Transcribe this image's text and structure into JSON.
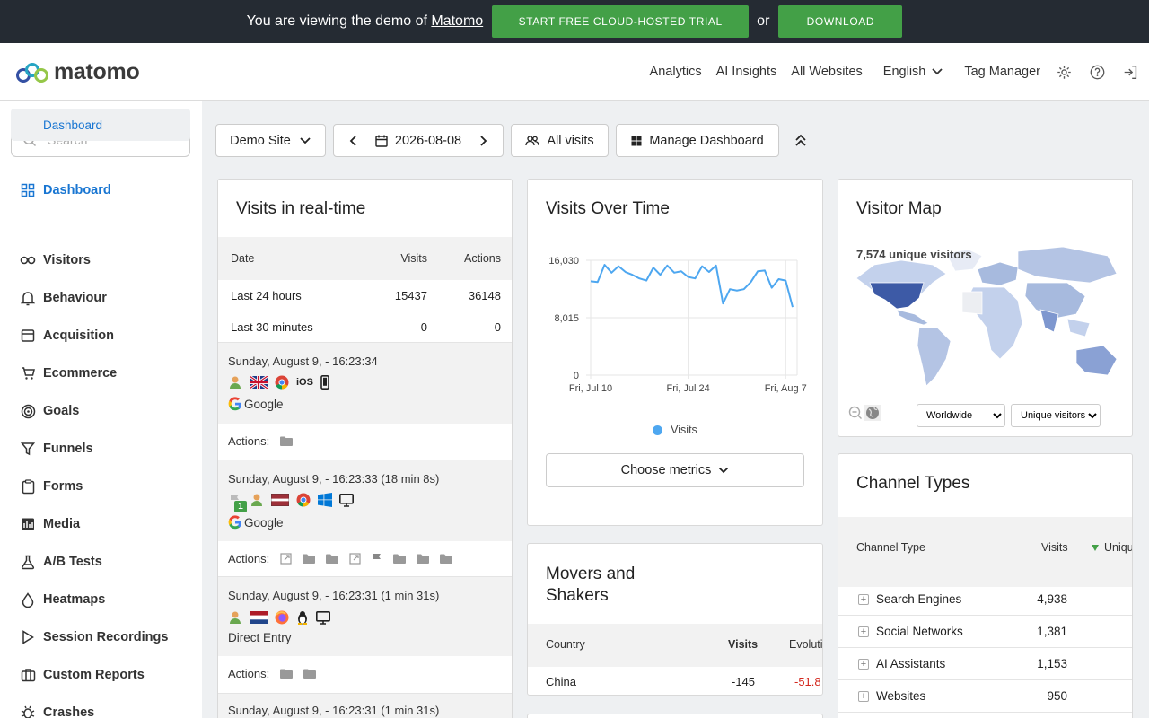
{
  "banner": {
    "text": "You are viewing the demo of",
    "link": "Matomo",
    "trial_button": "START FREE CLOUD-HOSTED TRIAL",
    "or": "or",
    "download_button": "DOWNLOAD"
  },
  "header": {
    "logo_text": "matomo",
    "nav": [
      "Analytics",
      "AI Insights",
      "All Websites",
      "English",
      "Tag Manager"
    ]
  },
  "sidebar": {
    "search_placeholder": "Search",
    "items": [
      {
        "label": "Dashboard",
        "icon": "dashboard-icon"
      },
      {
        "label": "Visitors",
        "icon": "visitors-icon"
      },
      {
        "label": "Behaviour",
        "icon": "bell-icon"
      },
      {
        "label": "Acquisition",
        "icon": "acquisition-icon"
      },
      {
        "label": "Ecommerce",
        "icon": "cart-icon"
      },
      {
        "label": "Goals",
        "icon": "target-icon"
      },
      {
        "label": "Funnels",
        "icon": "funnel-icon"
      },
      {
        "label": "Forms",
        "icon": "clipboard-icon"
      },
      {
        "label": "Media",
        "icon": "media-icon"
      },
      {
        "label": "A/B Tests",
        "icon": "flask-icon"
      },
      {
        "label": "Heatmaps",
        "icon": "drop-icon"
      },
      {
        "label": "Session Recordings",
        "icon": "play-icon"
      },
      {
        "label": "Custom Reports",
        "icon": "briefcase-icon"
      },
      {
        "label": "Crashes",
        "icon": "bug-icon"
      }
    ],
    "subitem": "Dashboard"
  },
  "toolbar": {
    "site": "Demo Site",
    "date": "2026-08-08",
    "segment": "All visits",
    "manage": "Manage Dashboard"
  },
  "realtime": {
    "title": "Visits in real-time",
    "columns": [
      "Date",
      "Visits",
      "Actions"
    ],
    "rows": [
      {
        "label": "Last 24 hours",
        "visits": "15437",
        "actions": "36148"
      },
      {
        "label": "Last 30 minutes",
        "visits": "0",
        "actions": "0"
      }
    ],
    "visits": [
      {
        "time": "Sunday, August 9, - 16:23:34",
        "referrer": "Google",
        "actions_label": "Actions:"
      },
      {
        "time": "Sunday, August 9, - 16:23:33 (18 min 8s)",
        "referrer": "Google",
        "actions_label": "Actions:",
        "badge": "1"
      },
      {
        "time": "Sunday, August 9, - 16:23:31 (1 min 31s)",
        "referrer": "Direct Entry",
        "actions_label": "Actions:"
      },
      {
        "time": "Sunday, August 9, - 16:23:31 (1 min 31s)"
      }
    ],
    "os_ios": "iOS"
  },
  "visits_over_time": {
    "title": "Visits Over Time",
    "choose_metrics": "Choose metrics",
    "legend": "Visits"
  },
  "chart_data": {
    "type": "line",
    "title": "Visits Over Time",
    "x_ticks": [
      "Fri, Jul 10",
      "Fri, Jul 24",
      "Fri, Aug 7"
    ],
    "y_ticks": [
      "16,030",
      "8,015",
      "0"
    ],
    "ylim": [
      0,
      16030
    ],
    "series": [
      {
        "name": "Visits",
        "x": [
          "Jul 10",
          "Jul 11",
          "Jul 12",
          "Jul 13",
          "Jul 14",
          "Jul 15",
          "Jul 16",
          "Jul 17",
          "Jul 18",
          "Jul 19",
          "Jul 20",
          "Jul 21",
          "Jul 22",
          "Jul 23",
          "Jul 24",
          "Jul 25",
          "Jul 26",
          "Jul 27",
          "Jul 28",
          "Jul 29",
          "Jul 30",
          "Jul 31",
          "Aug 1",
          "Aug 2",
          "Aug 3",
          "Aug 4",
          "Aug 5",
          "Aug 6",
          "Aug 7",
          "Aug 8"
        ],
        "values": [
          13100,
          13000,
          15400,
          14300,
          15200,
          14400,
          14000,
          13500,
          13200,
          15000,
          14000,
          15300,
          14300,
          14500,
          13700,
          13500,
          15200,
          14400,
          15300,
          10000,
          12000,
          11800,
          12000,
          13000,
          14500,
          14600,
          12200,
          13400,
          13200,
          9500
        ]
      }
    ],
    "grid": true,
    "legend_position": "bottom"
  },
  "visitor_map": {
    "title": "Visitor Map",
    "summary": "7,574 unique visitors",
    "region_select": "Worldwide",
    "metric_select": "Unique visitors"
  },
  "movers": {
    "title_line1": "Movers and",
    "title_line2": "Shakers",
    "columns": [
      "Country",
      "Visits",
      "Evoluti"
    ],
    "rows": [
      {
        "country": "China",
        "visits": "-145",
        "evolution": "-51.8"
      }
    ]
  },
  "channels": {
    "title": "Channel Types",
    "columns": [
      "Channel Type",
      "Visits",
      "Uniqu"
    ],
    "rows": [
      {
        "label": "Search Engines",
        "visits": "4,938"
      },
      {
        "label": "Social Networks",
        "visits": "1,381"
      },
      {
        "label": "AI Assistants",
        "visits": "1,153"
      },
      {
        "label": "Websites",
        "visits": "950"
      }
    ]
  },
  "colors": {
    "primary": "#1976d2",
    "green": "#43a047",
    "line": "#4ea7f0",
    "negative": "#d4291f"
  }
}
